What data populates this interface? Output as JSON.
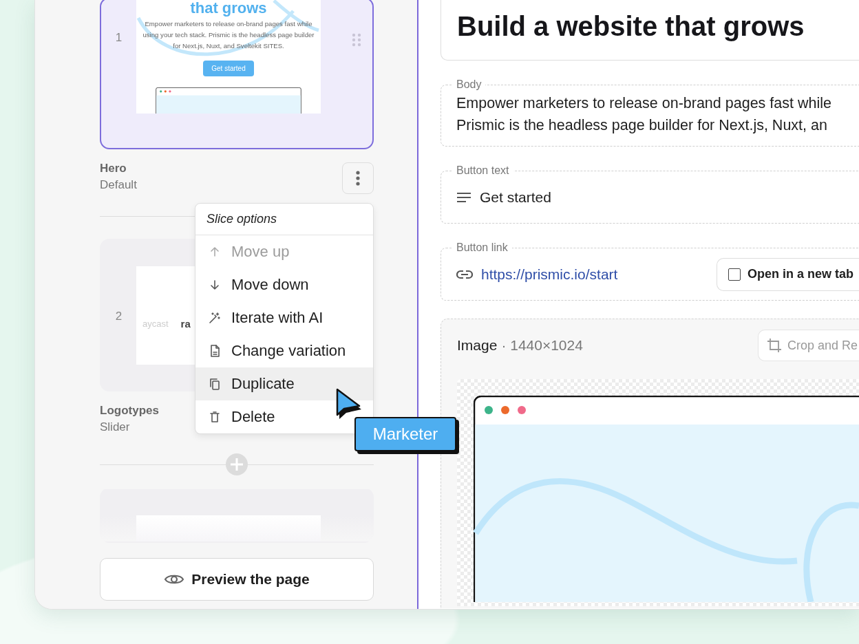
{
  "sidebar": {
    "slices": [
      {
        "number": "1",
        "name": "Hero",
        "variation": "Default",
        "selected": true,
        "preview": {
          "kind": "hero",
          "heading": "that grows",
          "body": "Empower marketers to release on-brand pages fast while using your tech stack. Prismic is the headless page builder for Next.js, Nuxt, and Sveltekit SITES.",
          "button": "Get started"
        }
      },
      {
        "number": "2",
        "name": "Logotypes",
        "variation": "Slider",
        "selected": false,
        "preview": {
          "kind": "logos",
          "logos": [
            "aycast",
            "ra"
          ]
        }
      },
      {
        "selected": false,
        "preview": {
          "kind": "blank"
        }
      }
    ],
    "preview_button": "Preview the page"
  },
  "slice_menu": {
    "title": "Slice options",
    "items": [
      {
        "kind": "move-up",
        "label": "Move up",
        "disabled": true,
        "selected": false
      },
      {
        "kind": "move-down",
        "label": "Move down",
        "disabled": false,
        "selected": false
      },
      {
        "kind": "ai",
        "label": "Iterate with AI",
        "disabled": false,
        "selected": false
      },
      {
        "kind": "variation",
        "label": "Change variation",
        "disabled": false,
        "selected": false
      },
      {
        "kind": "duplicate",
        "label": "Duplicate",
        "disabled": false,
        "selected": true
      },
      {
        "kind": "delete",
        "label": "Delete",
        "disabled": false,
        "selected": false
      }
    ]
  },
  "cursor": {
    "label": "Marketer"
  },
  "editor": {
    "title": "Build a website that grows",
    "fields": [
      {
        "kind": "rich",
        "label": "Body",
        "lines": [
          "Empower marketers to release on-brand pages fast while",
          "Prismic is the headless page builder for Next.js, Nuxt, an"
        ]
      },
      {
        "kind": "text",
        "label": "Button text",
        "value": "Get started"
      },
      {
        "kind": "link",
        "label": "Button link",
        "value": "https://prismic.io/start",
        "checkbox": {
          "label": "Open in a new tab",
          "checked": false
        }
      },
      {
        "kind": "image",
        "label": "Image",
        "dimensions": "· 1440×1024",
        "action": "Crop and Re"
      }
    ]
  }
}
